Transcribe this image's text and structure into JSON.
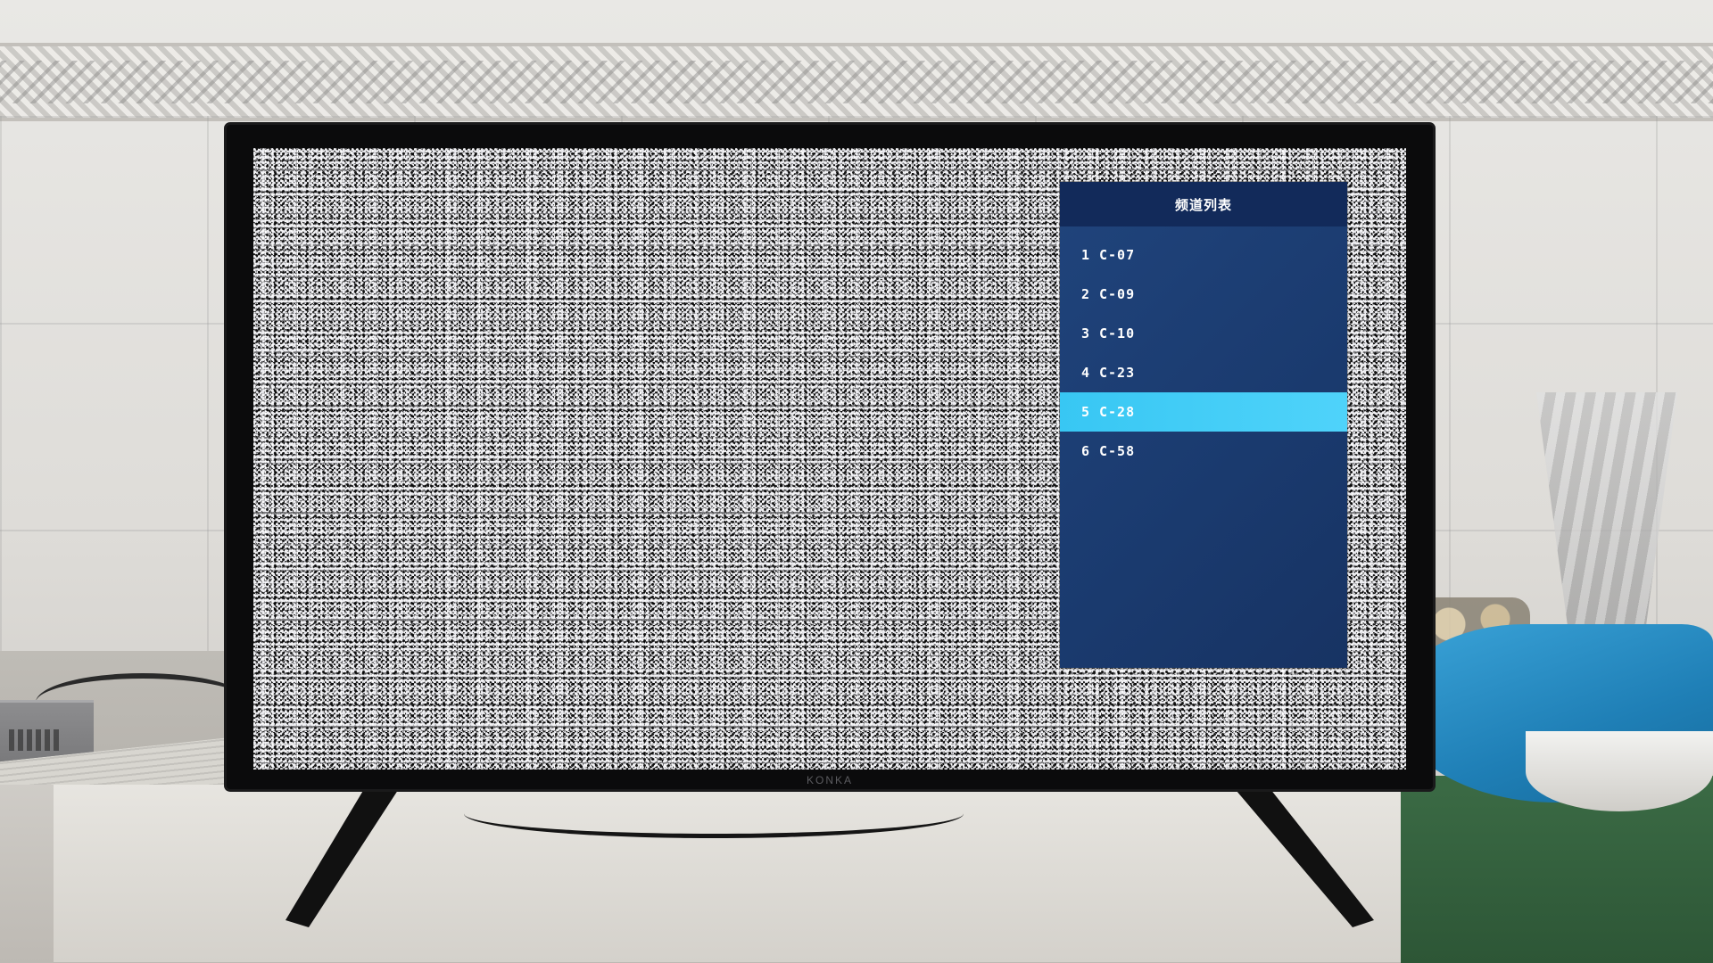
{
  "tv": {
    "brand": "KONKA"
  },
  "channel_list": {
    "title": "频道列表",
    "selected_index": 4,
    "highlight_color": "#3fcaf5",
    "panel_color": "#1d3f74",
    "items": [
      {
        "number": "1",
        "name": "C-07"
      },
      {
        "number": "2",
        "name": "C-09"
      },
      {
        "number": "3",
        "name": "C-10"
      },
      {
        "number": "4",
        "name": "C-23"
      },
      {
        "number": "5",
        "name": "C-28"
      },
      {
        "number": "6",
        "name": "C-58"
      }
    ]
  }
}
